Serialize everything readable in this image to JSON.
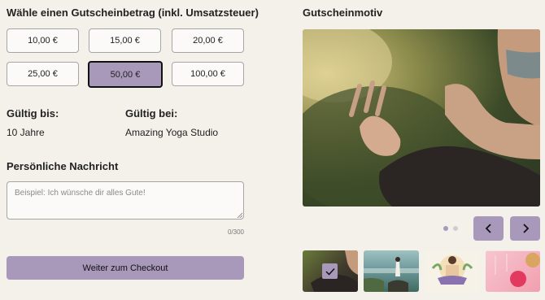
{
  "amount_section": {
    "title": "Wähle einen Gutscheinbetrag (inkl. Umsatzsteuer)",
    "options": [
      "10,00 €",
      "15,00 €",
      "20,00 €",
      "25,00 €",
      "50,00 €",
      "100,00 €"
    ],
    "selected": "50,00 €"
  },
  "validity": {
    "until_label": "Gültig bis:",
    "until_value": "10 Jahre",
    "at_label": "Gültig bei:",
    "at_value": "Amazing Yoga Studio"
  },
  "message": {
    "title": "Persönliche Nachricht",
    "placeholder": "Beispiel: Ich wünsche dir alles Gute!",
    "value": "",
    "char_count": "0/300"
  },
  "checkout": {
    "label": "Weiter zum Checkout"
  },
  "motif": {
    "title": "Gutscheinmotiv",
    "current_slide": 1,
    "total_slides": 2,
    "selected_thumbnail": 1
  },
  "colors": {
    "accent": "#a899bb",
    "background": "#f4f1eb"
  },
  "icons": {
    "prev": "chevron-left-icon",
    "next": "chevron-right-icon",
    "selected": "check-icon"
  }
}
